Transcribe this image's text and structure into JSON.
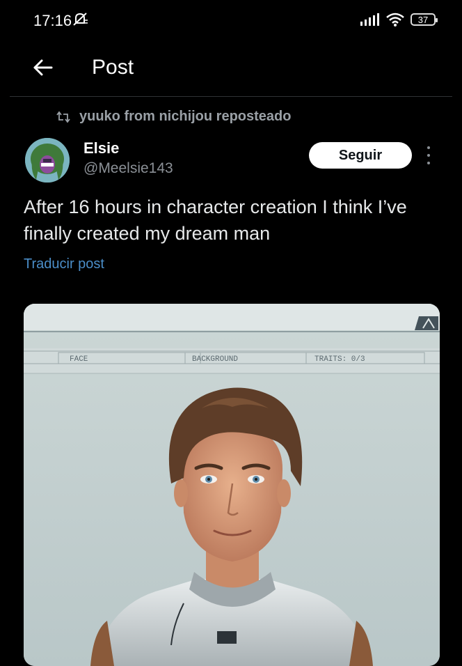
{
  "status_bar": {
    "time": "17:16",
    "battery": "37",
    "icons": [
      "mute-icon",
      "signal-icon",
      "wifi-icon",
      "battery-icon"
    ]
  },
  "header": {
    "title": "Post",
    "back_icon": "arrow-left-icon"
  },
  "repost": {
    "text": "yuuko from nichijou reposteado",
    "icon": "repost-icon"
  },
  "author": {
    "name": "Elsie",
    "handle": "@Meelsie143"
  },
  "follow_label": "Seguir",
  "post": {
    "text": "After 16 hours in character creation I think I’ve finally created my dream man",
    "translate_label": "Traducir post"
  },
  "media": {
    "tabs": [
      "FACE",
      "BACKGROUND",
      "TRAITS: 0/3"
    ]
  },
  "colors": {
    "background": "#000000",
    "text": "#e7e9ea",
    "muted": "#8b9096",
    "link": "#4b8ec9",
    "follow_bg": "#ffffff"
  }
}
